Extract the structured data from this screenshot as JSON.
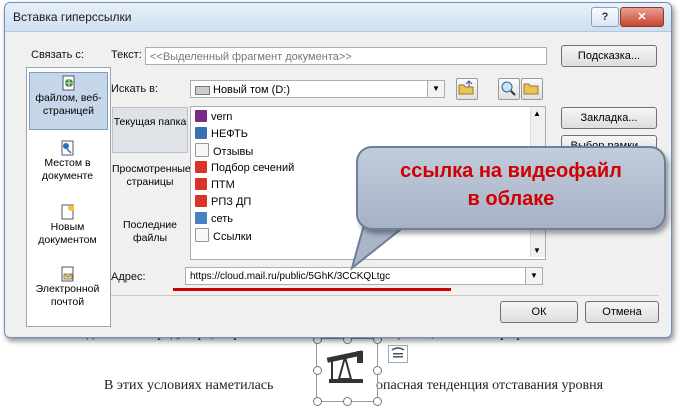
{
  "dialog": {
    "title": "Вставка гиперссылки",
    "help_label": "?",
    "close_label": "✕"
  },
  "link_to": {
    "label": "Связать с:",
    "items": [
      {
        "label": "файлом, веб-страницей",
        "icon": "globe-page-icon",
        "selected": true
      },
      {
        "label": "Местом в документе",
        "icon": "bookmark-doc-icon"
      },
      {
        "label": "Новым документом",
        "icon": "new-doc-icon"
      },
      {
        "label": "Электронной почтой",
        "icon": "email-icon"
      }
    ]
  },
  "text_to_display": {
    "label": "Текст:",
    "value": "<<Выделенный фрагмент документа>>"
  },
  "look_in": {
    "label": "Искать в:",
    "value": "Новый том (D:)"
  },
  "bookmarks": [
    {
      "label": "Текущая папка",
      "selected": true
    },
    {
      "label": "Просмотренные страницы"
    },
    {
      "label": "Последние файлы"
    }
  ],
  "files": [
    {
      "name": "vern",
      "icon": "archive-icon",
      "color": "#7a2b8a"
    },
    {
      "name": "НЕФТЬ",
      "icon": "oil-icon",
      "color": "#3a6fb0"
    },
    {
      "name": "Отзывы",
      "icon": "doc-icon",
      "color": "#f2f2f2"
    },
    {
      "name": "Подбор сечений",
      "icon": "pdf-icon",
      "color": "#d9342b"
    },
    {
      "name": "ПТМ",
      "icon": "pdf-icon",
      "color": "#d9342b"
    },
    {
      "name": "РПЗ ДП",
      "icon": "pdf-icon",
      "color": "#d9342b"
    },
    {
      "name": "сеть",
      "icon": "network-icon",
      "color": "#4a7fc1"
    },
    {
      "name": "Ссылки",
      "icon": "doc-icon",
      "color": "#f2f2f2"
    }
  ],
  "address": {
    "label": "Адрес:",
    "value": "https://cloud.mail.ru/public/5GhK/3CCKQLtgc"
  },
  "buttons": {
    "screentip": "Подсказка...",
    "bookmark": "Закладка...",
    "target_frame": "Выбор рамки...",
    "ok": "ОК",
    "cancel": "Отмена"
  },
  "callout": {
    "line1": "ссылка на видеофайл",
    "line2": "в облаке"
  },
  "document": {
    "line_top": "находятся кислород, сера, асфальтовые и смолистые вещества, а также парафин.",
    "line_bottom_left": "В этих условиях наметилась",
    "line_bottom_right": "опасная тенденция отставания уровня"
  },
  "colors": {
    "callout_text": "#d00000",
    "address_underline": "#d00000",
    "selected_item": "#c7d7ea"
  }
}
